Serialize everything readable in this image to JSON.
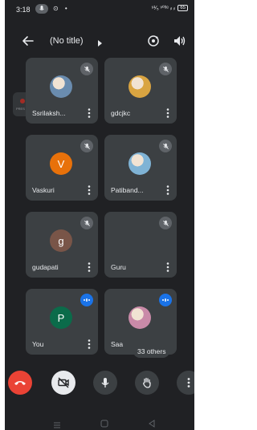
{
  "status_bar": {
    "time": "3:18",
    "left_icons": "⊙ •",
    "right_icons": "⁹¹⁄₅ ᵛ⁰ˡᵗᵉ ᵢₗ ᵢₗ",
    "battery": "65"
  },
  "header": {
    "title": "(No title)"
  },
  "side_chip": {
    "label": "PRES"
  },
  "participants": [
    {
      "name": "Ssrilaksh...",
      "avatar_type": "photo",
      "avatar_color": "#6a8caf",
      "state": "muted"
    },
    {
      "name": "gdcjkc",
      "avatar_type": "photo",
      "avatar_color": "#d9a441",
      "state": "muted"
    },
    {
      "name": "Vaskuri",
      "avatar_type": "letter",
      "initial": "V",
      "avatar_color": "#e8710a",
      "state": "muted"
    },
    {
      "name": "Patiband...",
      "avatar_type": "photo",
      "avatar_color": "#7fb3d5",
      "state": "muted"
    },
    {
      "name": "gudapati",
      "avatar_type": "letter",
      "initial": "g",
      "avatar_color": "#795548",
      "state": "muted"
    },
    {
      "name": "Guru",
      "avatar_type": "none",
      "avatar_color": "#3c4043",
      "state": "muted"
    },
    {
      "name": "You",
      "avatar_type": "letter",
      "initial": "P",
      "avatar_color": "#0b6b4a",
      "state": "speaking"
    },
    {
      "name": "Saa",
      "avatar_type": "photo",
      "avatar_color": "#c98aa8",
      "state": "speaking"
    }
  ],
  "others_badge": "33 others",
  "colors": {
    "background": "#202124",
    "tile": "#3c4043",
    "hangup": "#ea4335",
    "accent_blue": "#1a73e8"
  },
  "controls": [
    "hangup-icon",
    "camera-off-icon",
    "mic-icon",
    "raise-hand-icon",
    "more-vert-icon"
  ]
}
